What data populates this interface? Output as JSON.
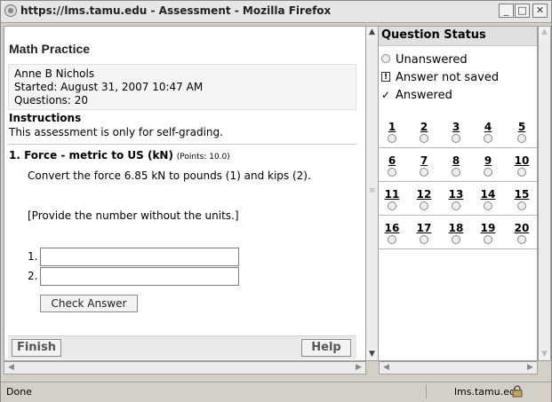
{
  "window": {
    "title": "https://lms.tamu.edu - Assessment - Mozilla Firefox",
    "controls": {
      "minimize": "_",
      "maximize": "□",
      "close": "✕"
    }
  },
  "assessment": {
    "title": "Math Practice",
    "student": "Anne B Nichols",
    "started": "Started: August 31, 2007 10:47 AM",
    "questions": "Questions: 20",
    "instructions_heading": "Instructions",
    "instructions_text": "This assessment is only for self-grading."
  },
  "question": {
    "header": "1. Force - metric to US (kN)",
    "points": "(Points: 10.0)",
    "text": "Convert the force 6.85 kN to pounds (1) and kips (2).",
    "note": "[Provide the number without the units.]",
    "answers": [
      {
        "label": "1.",
        "value": ""
      },
      {
        "label": "2.",
        "value": ""
      }
    ],
    "check_label": "Check Answer"
  },
  "footer": {
    "finish_label": "Finish",
    "help_label": "Help"
  },
  "status_panel": {
    "heading": "Question Status",
    "legend": {
      "unanswered": "Unanswered",
      "not_saved": "Answer not saved",
      "answered": "Answered"
    },
    "rows": [
      [
        "1",
        "2",
        "3",
        "4",
        "5"
      ],
      [
        "6",
        "7",
        "8",
        "9",
        "10"
      ],
      [
        "11",
        "12",
        "13",
        "14",
        "15"
      ],
      [
        "16",
        "17",
        "18",
        "19",
        "20"
      ]
    ]
  },
  "statusbar": {
    "left": "Done",
    "host": "lms.tamu.edu"
  }
}
